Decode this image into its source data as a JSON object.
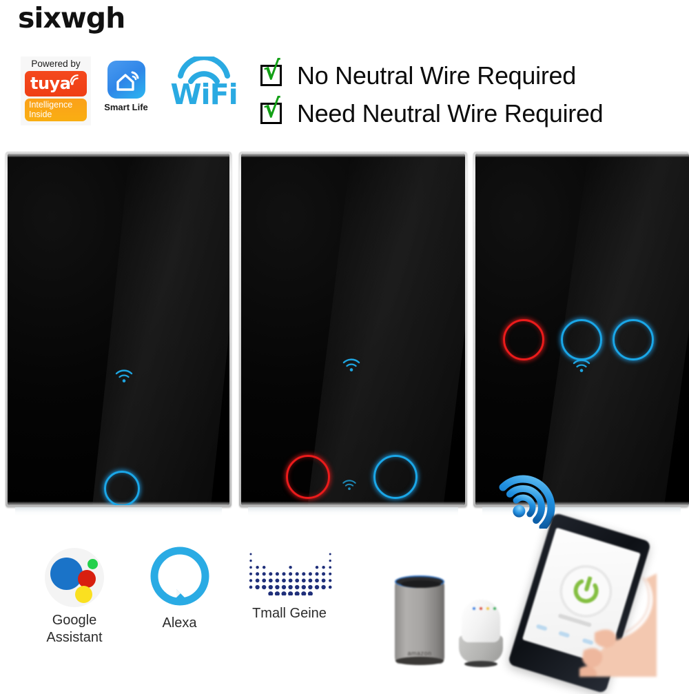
{
  "brand": {
    "name": "sixwgh"
  },
  "badges": {
    "tuya": {
      "powered_by": "Powered by",
      "word": "tuya",
      "sub_line1": "Intelligence",
      "sub_line2": "Inside",
      "icon": "tuya-wifi-icon",
      "color_primary": "#ef3e14",
      "color_secondary": "#fba11a"
    },
    "smart_life": {
      "label": "Smart Life",
      "icon": "smart-home-icon",
      "color": "#2f86e8"
    },
    "wifi": {
      "label": "WiFi",
      "icon": "wifi-icon",
      "color": "#2aaae2"
    }
  },
  "features": [
    {
      "checked": true,
      "mark": "√",
      "label": "No Neutral Wire Required"
    },
    {
      "checked": true,
      "mark": "√",
      "label": "Need Neutral Wire Required"
    }
  ],
  "products": [
    {
      "name": "1-gang touch switch",
      "gangs": 1,
      "wifi_indicator": true,
      "buttons": [
        {
          "position": 1,
          "state": "on",
          "color": "#1aa7e8",
          "color_name": "cyan"
        }
      ]
    },
    {
      "name": "2-gang touch switch",
      "gangs": 2,
      "wifi_indicator": true,
      "buttons": [
        {
          "position": 1,
          "state": "off",
          "color": "#ec1b1b",
          "color_name": "red"
        },
        {
          "position": 2,
          "state": "on",
          "color": "#1aa7e8",
          "color_name": "cyan"
        }
      ]
    },
    {
      "name": "3-gang touch switch",
      "gangs": 3,
      "wifi_indicator": true,
      "overlay_icon": "wifi-3d-icon",
      "overlay_color": "#1d8fe0",
      "buttons": [
        {
          "position": 1,
          "state": "off",
          "color": "#ec1b1b",
          "color_name": "red"
        },
        {
          "position": 2,
          "state": "on",
          "color": "#1aa7e8",
          "color_name": "cyan"
        },
        {
          "position": 3,
          "state": "on",
          "color": "#1aa7e8",
          "color_name": "cyan"
        }
      ]
    }
  ],
  "assistants": [
    {
      "id": "google-assistant",
      "label_line1": "Google",
      "label_line2": "Assistant",
      "icon": "google-assistant-icon"
    },
    {
      "id": "alexa",
      "label_line1": "Alexa",
      "label_line2": "",
      "icon": "alexa-icon",
      "color": "#2aaae2"
    },
    {
      "id": "tmall-genie",
      "label_line1": "Tmall Geine",
      "label_line2": "",
      "icon": "tmall-genie-icon",
      "color": "#1f2f7a"
    }
  ],
  "devices": {
    "echo": {
      "name": "Amazon Echo",
      "wordmark": "amazon"
    },
    "google_home": {
      "name": "Google Home"
    },
    "phone": {
      "name": "smartphone-app",
      "app_icon": "power-button-icon",
      "app_icon_color": "#84bf41"
    }
  }
}
